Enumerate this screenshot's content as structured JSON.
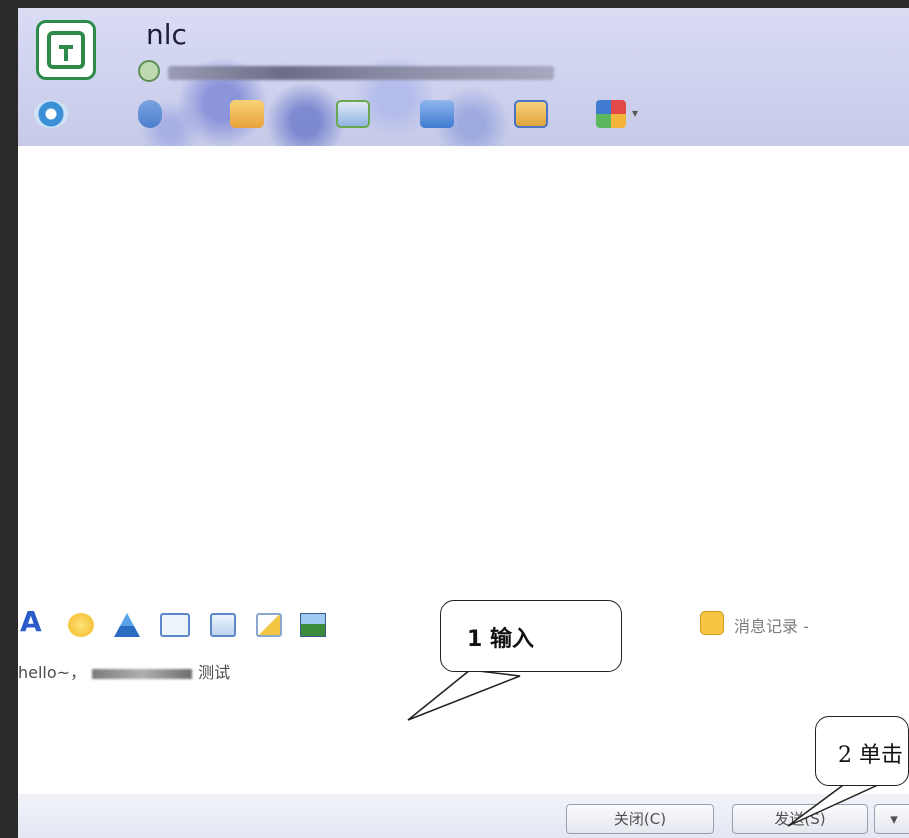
{
  "header": {
    "contact_name": "nlc"
  },
  "toolbar_icons": [
    {
      "icon": "video-eye-icon",
      "color": "#3a8fd6"
    },
    {
      "icon": "microphone-icon",
      "color": "#4d7fcc"
    },
    {
      "icon": "send-file-icon",
      "color": "#e9a23b"
    },
    {
      "icon": "remote-assist-icon",
      "color": "#6aa84f"
    },
    {
      "icon": "share-screen-icon",
      "color": "#3f7bd0"
    },
    {
      "icon": "send-folder-icon",
      "color": "#e0a33a"
    },
    {
      "icon": "apps-grid-icon",
      "color": "#e24a4a"
    }
  ],
  "format_toolbar": {
    "font_label": "A",
    "icons": [
      "emoji-icon",
      "magic-icon",
      "screenshot-icon",
      "music-icon",
      "doodle-icon",
      "image-icon"
    ],
    "history_label": "消息记录 -"
  },
  "input": {
    "text_before": "hello~，",
    "text_after": "测试"
  },
  "buttons": {
    "close": "关闭(C)",
    "send": "发送(S)",
    "send_options": "▾"
  },
  "callouts": {
    "first": "1 输入",
    "second": "2 单击"
  }
}
